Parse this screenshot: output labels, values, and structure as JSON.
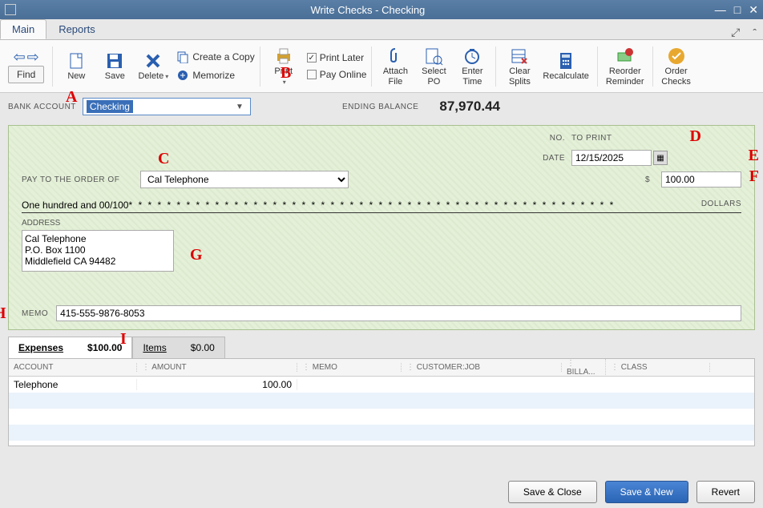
{
  "window": {
    "title": "Write Checks - Checking"
  },
  "tabs": {
    "main": "Main",
    "reports": "Reports"
  },
  "ribbon": {
    "find": "Find",
    "new": "New",
    "save": "Save",
    "delete": "Delete",
    "create_copy": "Create a Copy",
    "memorize": "Memorize",
    "print": "Print",
    "print_later": "Print Later",
    "pay_online": "Pay Online",
    "attach_file": "Attach\nFile",
    "select_po": "Select\nPO",
    "enter_time": "Enter\nTime",
    "clear_splits": "Clear\nSplits",
    "recalculate": "Recalculate",
    "reorder_reminder": "Reorder\nReminder",
    "order_checks": "Order\nChecks"
  },
  "topfields": {
    "bank_account_label": "BANK ACCOUNT",
    "bank_account_value": "Checking",
    "ending_balance_label": "ENDING BALANCE",
    "ending_balance_value": "87,970.44"
  },
  "check": {
    "no_label": "NO.",
    "no_value": "TO PRINT",
    "date_label": "DATE",
    "date_value": "12/15/2025",
    "pay_label": "PAY TO THE ORDER OF",
    "payee": "Cal Telephone",
    "dollar": "$",
    "amount": "100.00",
    "amount_words": "One hundred and 00/100",
    "dollars": "DOLLARS",
    "address_label": "ADDRESS",
    "address": "Cal Telephone\nP.O. Box 1100\nMiddlefield CA 94482",
    "memo_label": "MEMO",
    "memo": "415-555-9876-8053"
  },
  "annotations": {
    "A": "A",
    "B": "B",
    "C": "C",
    "D": "D",
    "E": "E",
    "F": "F",
    "G": "G",
    "H": "H",
    "I": "I"
  },
  "split_tabs": {
    "expenses_label": "Expenses",
    "expenses_amt": "$100.00",
    "items_label": "Items",
    "items_amt": "$0.00"
  },
  "grid": {
    "headers": {
      "account": "ACCOUNT",
      "amount": "AMOUNT",
      "memo": "MEMO",
      "customer": "CUSTOMER:JOB",
      "billable": "BILLA...",
      "class": "CLASS"
    },
    "rows": [
      {
        "account": "Telephone",
        "amount": "100.00",
        "memo": "",
        "customer": "",
        "billable": "",
        "class": ""
      },
      {
        "account": "",
        "amount": "",
        "memo": "",
        "customer": "",
        "billable": "",
        "class": ""
      },
      {
        "account": "",
        "amount": "",
        "memo": "",
        "customer": "",
        "billable": "",
        "class": ""
      },
      {
        "account": "",
        "amount": "",
        "memo": "",
        "customer": "",
        "billable": "",
        "class": ""
      }
    ]
  },
  "footer": {
    "save_close": "Save & Close",
    "save_new": "Save & New",
    "revert": "Revert"
  }
}
